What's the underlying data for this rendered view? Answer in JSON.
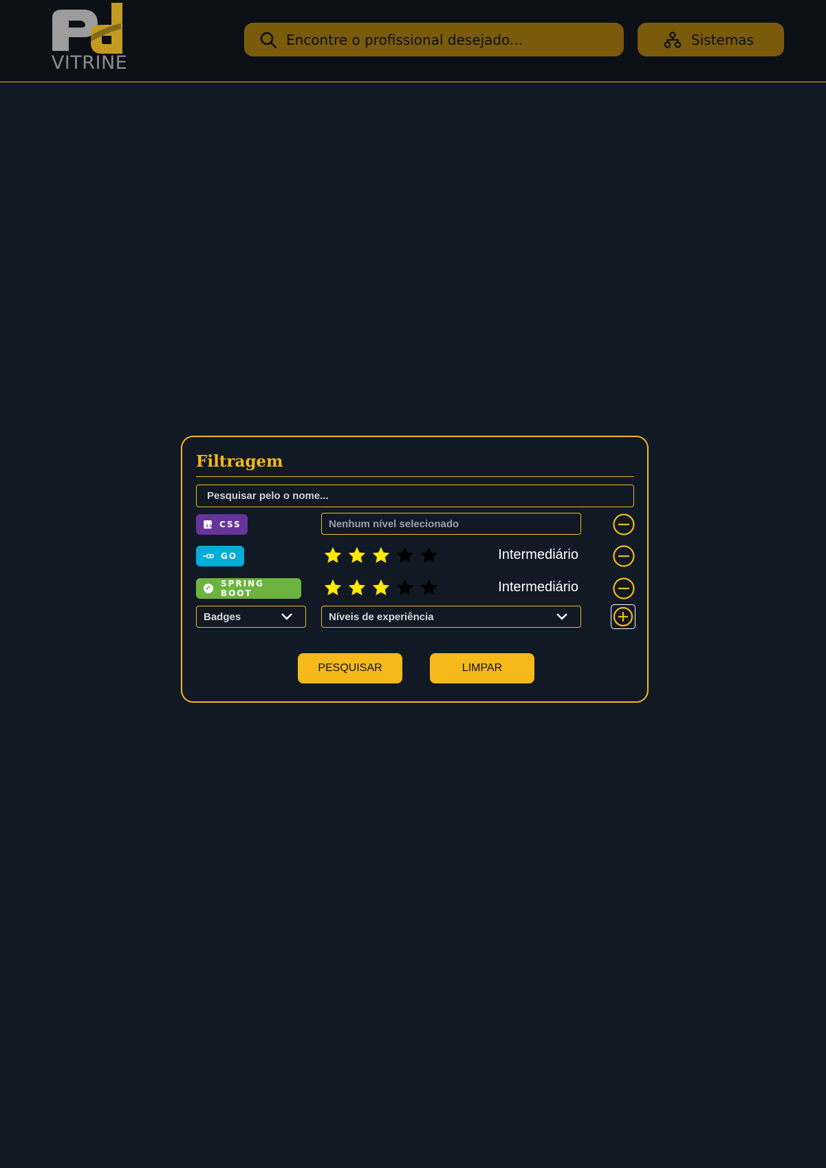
{
  "header": {
    "logo_text": "VITRINE",
    "search_placeholder": "Encontre o profissional desejado...",
    "systems_label": "Sistemas"
  },
  "filter": {
    "title": "Filtragem",
    "name_placeholder": "Pesquisar pelo o nome...",
    "rows": [
      {
        "badge": "CSS",
        "badge_color": "#663399",
        "level_placeholder": "Nenhum nível selecionado"
      },
      {
        "badge": "GO",
        "badge_color": "#00ADD8",
        "stars": 3,
        "max_stars": 5,
        "level": "Intermediário"
      },
      {
        "badge": "SPRING BOOT",
        "badge_color": "#6DB33F",
        "stars": 3,
        "max_stars": 5,
        "level": "Intermediário"
      }
    ],
    "badges_select": "Badges",
    "levels_select": "Níveis de experiência",
    "search_button": "PESQUISAR",
    "clear_button": "LIMPAR"
  },
  "colors": {
    "background": "#111925",
    "header": "#0b0f16",
    "accent": "#f5b91a",
    "header_button": "#7a5b0c",
    "star_on": "#ffea00",
    "star_off": "#000000"
  }
}
